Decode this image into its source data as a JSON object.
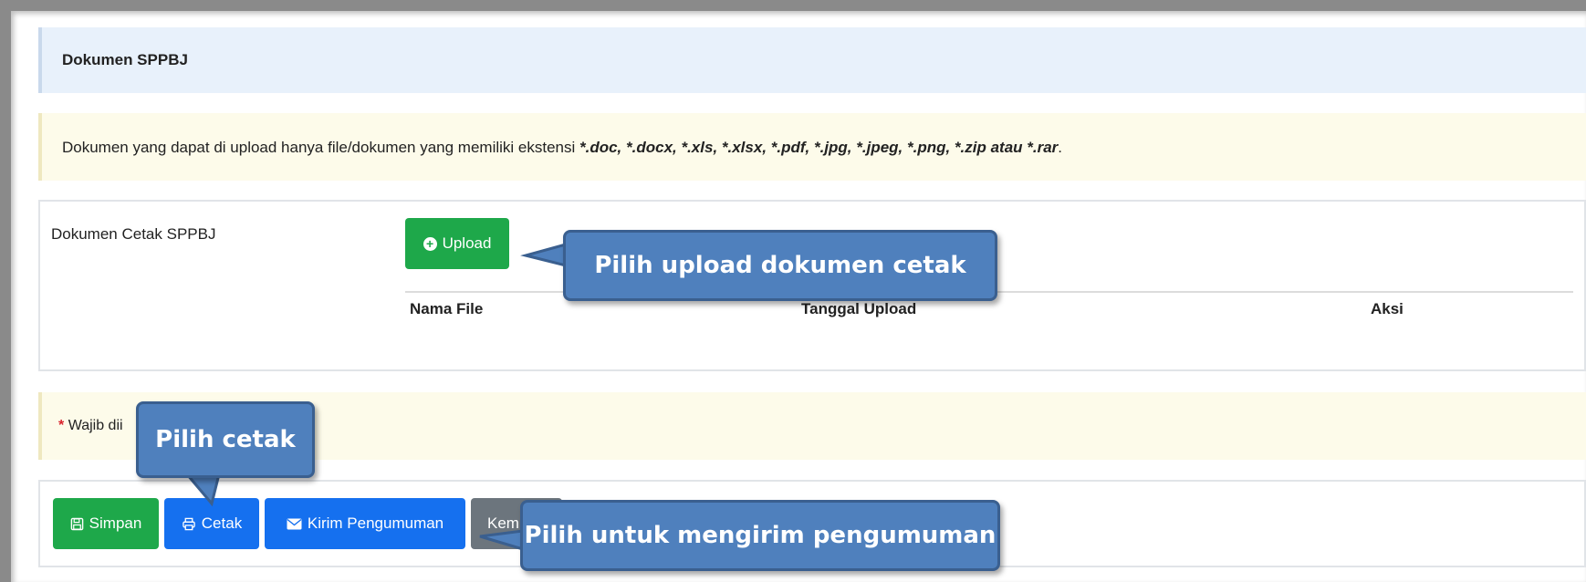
{
  "header": {
    "title": "Dokumen SPPBJ"
  },
  "notice": {
    "text_prefix": "Dokumen yang dapat di upload hanya file/dokumen yang memiliki ekstensi ",
    "extensions": "*.doc, *.docx, *.xls, *.xlsx, *.pdf, *.jpg, *.jpeg, *.png, *.zip atau *.rar",
    "suffix": "."
  },
  "document": {
    "label": "Dokumen Cetak SPPBJ",
    "upload_label": "Upload",
    "columns": [
      "Nama File",
      "Tanggal Upload",
      "Aksi"
    ]
  },
  "required": {
    "star": "*",
    "text": "Wajib dii"
  },
  "actions": {
    "simpan": "Simpan",
    "cetak": "Cetak",
    "kirim": "Kirim Pengumuman",
    "kembali": "Keml"
  },
  "callouts": {
    "upload": "Pilih upload dokumen cetak",
    "cetak": "Pilih cetak",
    "kirim": "Pilih untuk mengirim pengumuman"
  },
  "colors": {
    "green": "#1ea84a",
    "blue": "#1570ef",
    "gray": "#6c757d",
    "callout": "#4f80bd"
  },
  "icons": {
    "upload": "plus-circle-icon",
    "simpan": "floppy-disk-icon",
    "cetak": "printer-icon",
    "kirim": "envelope-icon"
  }
}
